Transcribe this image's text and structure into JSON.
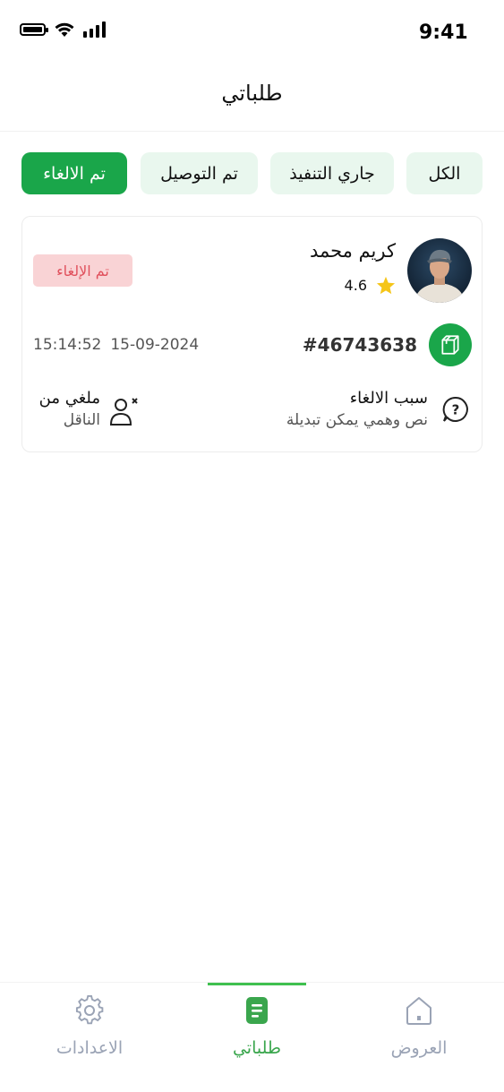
{
  "status_bar": {
    "time": "9:41"
  },
  "header": {
    "title": "طلباتي"
  },
  "filters": {
    "all": "الكل",
    "in_progress": "جاري التنفيذ",
    "delivered": "تم التوصيل",
    "cancelled": "تم الالغاء",
    "active": "cancelled"
  },
  "order": {
    "driver_name": "كريم محمد",
    "rating": "4.6",
    "status_badge": "تم الإلغاء",
    "order_number": "#46743638",
    "date": "15-09-2024",
    "time": "15:14:52",
    "reason_title": "سبب الالغاء",
    "reason_text": "نص وهمي يمكن تبديلة",
    "cancelled_by_title": "ملغي من",
    "cancelled_by": "الناقل"
  },
  "bottom_nav": {
    "settings": "الاعدادات",
    "orders": "طلباتي",
    "offers": "العروض",
    "active": "orders"
  },
  "colors": {
    "primary_green": "#1aa64a",
    "chip_bg": "#e9f7ee",
    "badge_bg": "#f9d3d5",
    "badge_text": "#e0505c",
    "nav_inactive": "#9aa3b5",
    "star": "#f5c518"
  },
  "icons": [
    "battery-icon",
    "wifi-icon",
    "signal-icon",
    "star-icon",
    "box-icon",
    "question-icon",
    "user-x-icon",
    "gear-icon",
    "document-icon",
    "home-icon"
  ]
}
